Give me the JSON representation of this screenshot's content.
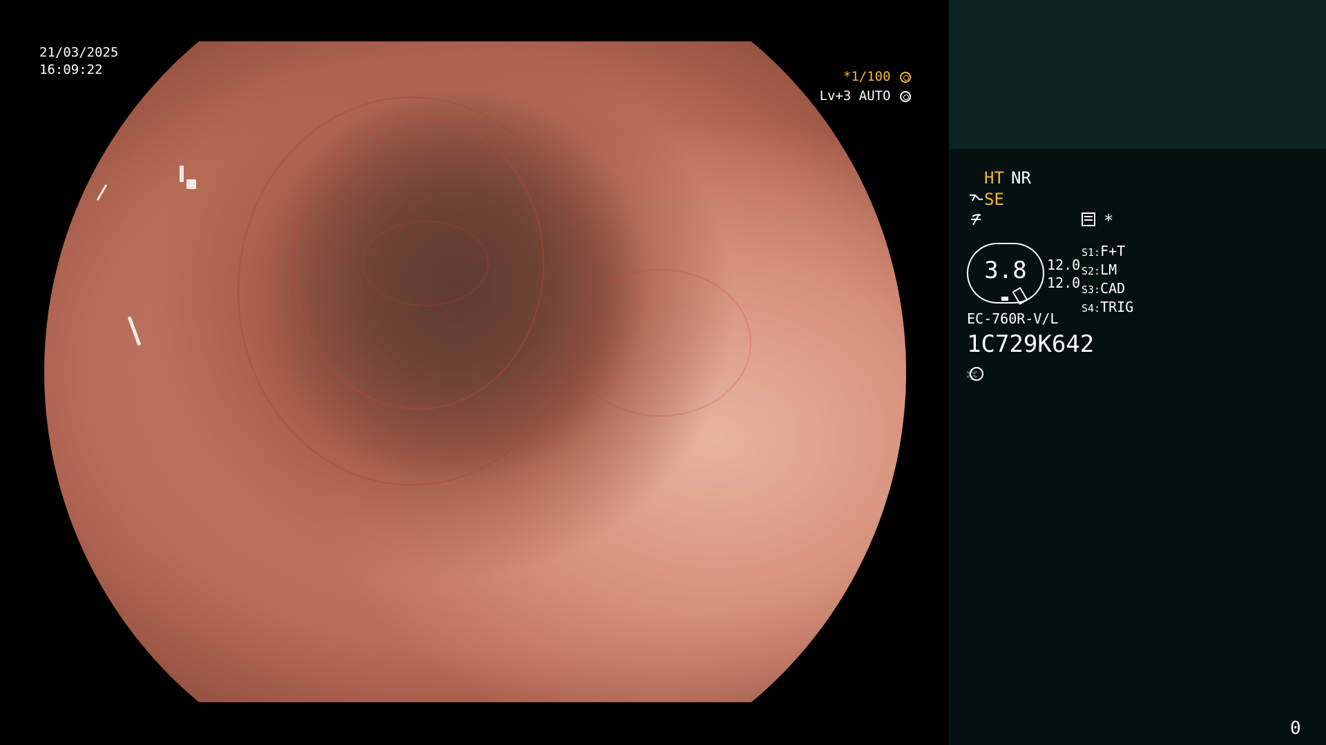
{
  "overlay": {
    "date": "21/03/2025",
    "time": "16:09:22",
    "shutter": "*1/100",
    "level": "Lv+3 AUTO"
  },
  "panel": {
    "ht": "HT",
    "nr": "NR",
    "se": "SE",
    "star": "*",
    "scale_value": "3.8",
    "values": [
      "12.0",
      "12.0"
    ],
    "switches": [
      {
        "key": "S1:",
        "value": "F+T"
      },
      {
        "key": "S2:",
        "value": "LM"
      },
      {
        "key": "S3:",
        "value": "CAD"
      },
      {
        "key": "S4:",
        "value": "TRIG"
      }
    ],
    "scope_model": "EC-760R-V/L",
    "serial": "1C729K642",
    "page_number": "0"
  },
  "colors": {
    "accent_orange": "#f4b440",
    "panel_bg": "#051110",
    "panel_header_bg": "#0c2324"
  },
  "icons": [
    "shutter-icon",
    "auto-iris-icon",
    "scope-icon",
    "enhance-icon",
    "menu-icon",
    "light-icon"
  ]
}
